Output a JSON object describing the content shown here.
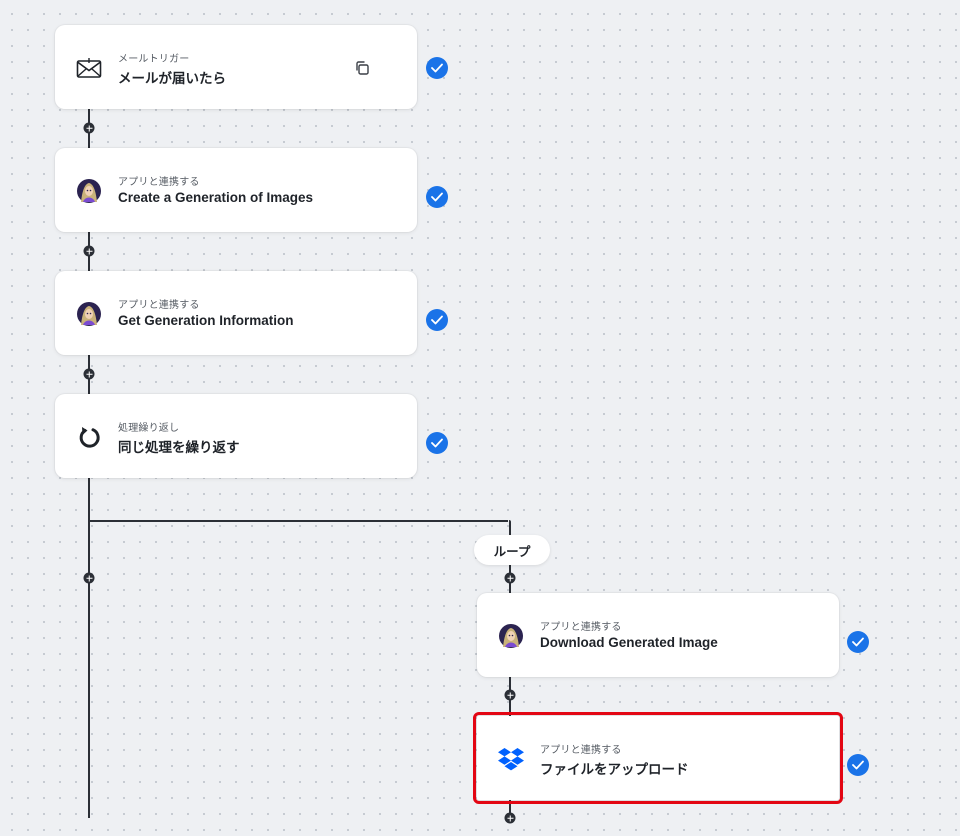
{
  "steps": [
    {
      "subtitle": "メールトリガー",
      "title": "メールが届いたら",
      "icon": "envelope-icon"
    },
    {
      "subtitle": "アプリと連携する",
      "title": "Create a Generation of Images",
      "icon": "ai-avatar-icon"
    },
    {
      "subtitle": "アプリと連携する",
      "title": "Get Generation Information",
      "icon": "ai-avatar-icon"
    },
    {
      "subtitle": "処理繰り返し",
      "title": "同じ処理を繰り返す",
      "icon": "loop-arrow-icon"
    }
  ],
  "loop": {
    "label": "ループ",
    "steps": [
      {
        "subtitle": "アプリと連携する",
        "title": "Download Generated Image",
        "icon": "ai-avatar-icon"
      },
      {
        "subtitle": "アプリと連携する",
        "title": "ファイルをアップロード",
        "icon": "dropbox-icon",
        "selected": true
      }
    ]
  },
  "colors": {
    "check": "#1a73e8",
    "selection_outline": "#e30613",
    "connector": "#2b2f36"
  }
}
